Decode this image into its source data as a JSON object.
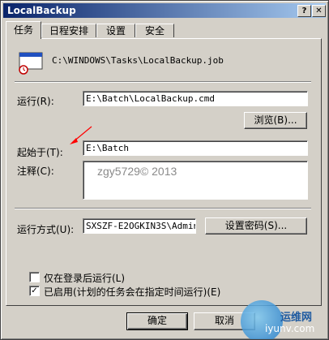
{
  "window": {
    "title": "LocalBackup"
  },
  "titlebar": {
    "help_label": "?",
    "close_label": "✕"
  },
  "tabs": [
    {
      "label": "任务",
      "active": true
    },
    {
      "label": "日程安排",
      "active": false
    },
    {
      "label": "设置",
      "active": false
    },
    {
      "label": "安全",
      "active": false
    }
  ],
  "task": {
    "job_path": "C:\\WINDOWS\\Tasks\\LocalBackup.job",
    "run_label": "运行(R):",
    "run_value": "E:\\Batch\\LocalBackup.cmd",
    "browse_label": "浏览(B)...",
    "start_in_label": "起始于(T):",
    "start_in_value": "E:\\Batch",
    "comment_label": "注释(C):",
    "comment_value": "",
    "run_as_label": "运行方式(U):",
    "run_as_value": "SXSZF-E2OGKIN3S\\Admini:",
    "set_password_label": "设置密码(S)...",
    "logged_on_label": "仅在登录后运行(L)",
    "logged_on_checked": false,
    "enabled_label": "已启用(计划的任务会在指定时间运行)(E)",
    "enabled_checked": true
  },
  "buttons": {
    "ok": "确定",
    "cancel": "取消"
  },
  "watermark": {
    "copyright": "zgy5729© 2013",
    "logo_cn": "运维网",
    "logo_site": "iyunv.com"
  },
  "colors": {
    "title_start": "#0a246a",
    "title_end": "#a6caf0",
    "face": "#d4d0c8",
    "arrow": "#ff0000"
  }
}
